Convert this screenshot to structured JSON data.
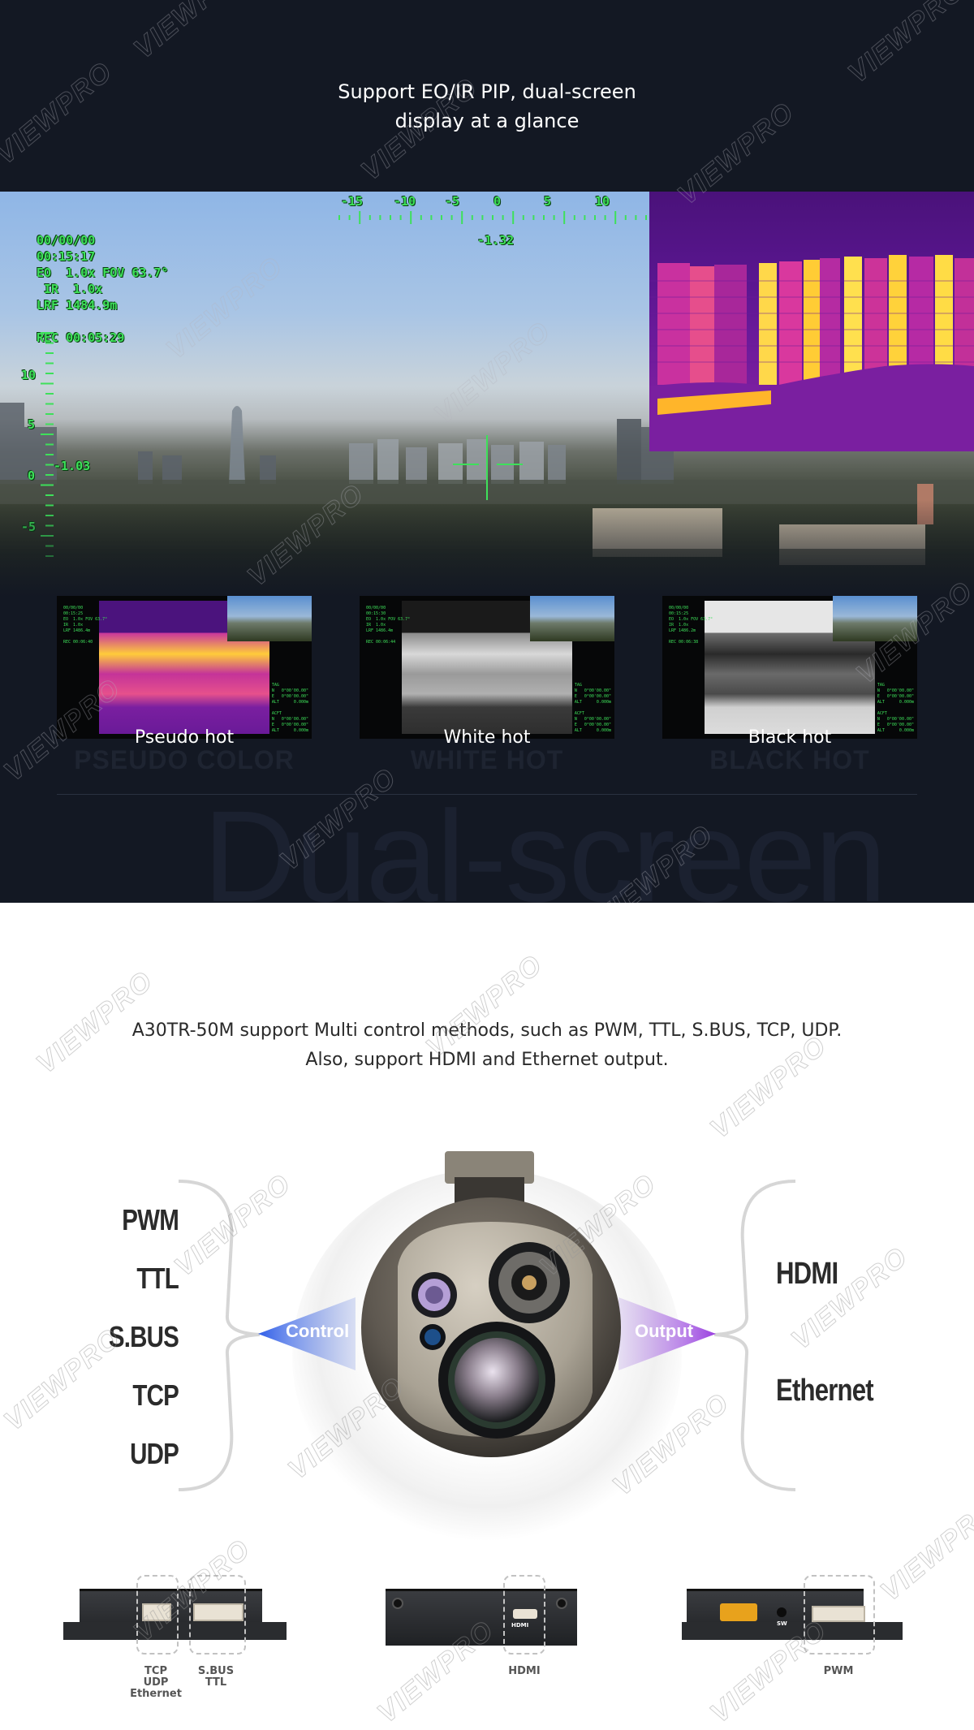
{
  "dark_section": {
    "headline_line1": "Support EO/IR PIP, dual-screen",
    "headline_line2": "display at a glance",
    "hero_osd": {
      "date": "00/00/00",
      "time": "00:15:17",
      "eo": "EO  1.0x FOV 63.7°",
      "ir": " IR  1.0x",
      "lrf": "LRF 1484.9m",
      "rec": "REC 00:05:29",
      "heading_scale": [
        "-15",
        "-10",
        "-5",
        "0",
        "5",
        "10"
      ],
      "heading_value": "-1.32",
      "pitch_scale": [
        "10",
        "5",
        "0",
        "-5"
      ],
      "pitch_value": "-1.03"
    },
    "thumbnails": [
      {
        "label": "Pseudo hot",
        "ghost_label": "PSEUDO COLOR",
        "palette": "ironbow",
        "osd_left": "00/00/00\n00:15:25\nEO  1.0x FOV 63.7°\nIR  1.0x\nLRF 1486.4m\n\nREC 00:06:40",
        "osd_right": "TAG\nN   0°00'00.00\"\nE   0°00'00.00\"\nALT      0.000m\n\nACFT\nN   0°00'00.00\"\nE   0°00'00.00\"\nALT      0.000m"
      },
      {
        "label": "White hot",
        "ghost_label": "WHITE HOT",
        "palette": "white-hot",
        "osd_left": "00/00/00\n00:15:30\nEO  1.0x FOV 63.7°\nIR  1.0x\nLRF 1486.4m\n\nREC 00:06:44",
        "osd_right": "TAG\nN   0°00'00.00\"\nE   0°00'00.00\"\nALT      0.000m\n\nACFT\nN   0°00'00.00\"\nE   0°00'00.00\"\nALT      0.000m"
      },
      {
        "label": "Black hot",
        "ghost_label": "BLACK HOT",
        "palette": "black-hot",
        "osd_left": "00/00/00\n00:15:25\nEO  1.0x FOV 63.7°\nIR  1.0x\nLRF 1486.2m\n\nREC 00:06:38",
        "osd_right": "TAG\nN   0°00'00.00\"\nE   0°00'00.00\"\nALT      0.000m\n\nACFT\nN   0°00'00.00\"\nE   0°00'00.00\"\nALT      0.000m"
      }
    ],
    "background_word": "Dual-screen"
  },
  "control_section": {
    "intro_line1": "A30TR-50M support Multi control methods, such as PWM, TTL, S.BUS, TCP, UDP.",
    "intro_line2": "Also, support HDMI and Ethernet output.",
    "control_methods": [
      "PWM",
      "TTL",
      "S.BUS",
      "TCP",
      "UDP"
    ],
    "control_label": "Control",
    "output_label": "Output",
    "outputs": [
      "HDMI",
      "Ethernet"
    ],
    "colors": {
      "control_accent": "#2f5ee8",
      "output_accent": "#9a3fe0"
    }
  },
  "interfaces": [
    {
      "ports": [
        {
          "label": "TCP\nUDP\nEthernet"
        },
        {
          "label": "S.BUS\nTTL"
        }
      ]
    },
    {
      "ports": [
        {
          "label": "HDMI",
          "silk": "HDMI"
        }
      ]
    },
    {
      "ports": [
        {
          "label": "PWM"
        }
      ],
      "silk": "SW"
    }
  ],
  "watermark": "VIEWPRO"
}
